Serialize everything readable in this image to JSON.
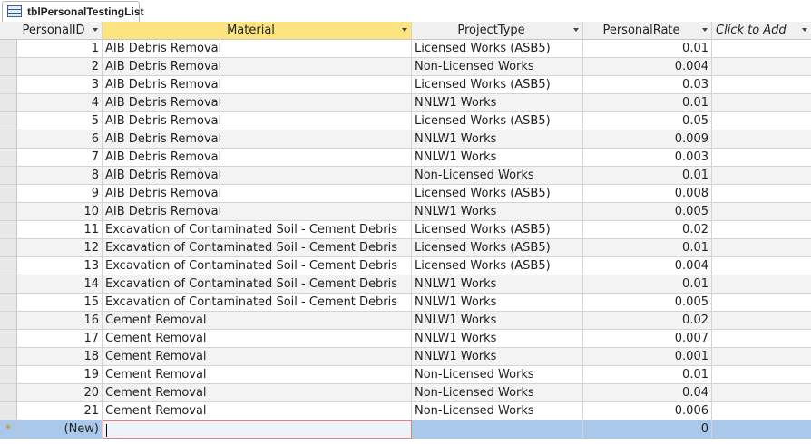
{
  "tab": {
    "title": "tblPersonalTestingList",
    "icon": "table-icon"
  },
  "columns": {
    "id": "PersonalID",
    "material": "Material",
    "project_type": "ProjectType",
    "personal_rate": "PersonalRate",
    "add": "Click to Add"
  },
  "rows": [
    {
      "id": "1",
      "material": "AIB Debris Removal",
      "project_type": "Licensed Works (ASB5)",
      "personal_rate": "0.01"
    },
    {
      "id": "2",
      "material": "AIB Debris Removal",
      "project_type": "Non-Licensed Works",
      "personal_rate": "0.004"
    },
    {
      "id": "3",
      "material": "AIB Debris Removal",
      "project_type": "Licensed Works (ASB5)",
      "personal_rate": "0.03"
    },
    {
      "id": "4",
      "material": "AIB Debris Removal",
      "project_type": "NNLW1 Works",
      "personal_rate": "0.01"
    },
    {
      "id": "5",
      "material": "AIB Debris Removal",
      "project_type": "Licensed Works (ASB5)",
      "personal_rate": "0.05"
    },
    {
      "id": "6",
      "material": "AIB Debris Removal",
      "project_type": "NNLW1 Works",
      "personal_rate": "0.009"
    },
    {
      "id": "7",
      "material": "AIB Debris Removal",
      "project_type": "NNLW1 Works",
      "personal_rate": "0.003"
    },
    {
      "id": "8",
      "material": "AIB Debris Removal",
      "project_type": "Non-Licensed Works",
      "personal_rate": "0.01"
    },
    {
      "id": "9",
      "material": "AIB Debris Removal",
      "project_type": "Licensed Works (ASB5)",
      "personal_rate": "0.008"
    },
    {
      "id": "10",
      "material": "AIB Debris Removal",
      "project_type": "NNLW1 Works",
      "personal_rate": "0.005"
    },
    {
      "id": "11",
      "material": "Excavation of Contaminated Soil - Cement Debris",
      "project_type": "Licensed Works (ASB5)",
      "personal_rate": "0.02"
    },
    {
      "id": "12",
      "material": "Excavation of Contaminated Soil - Cement Debris",
      "project_type": "Licensed Works (ASB5)",
      "personal_rate": "0.01"
    },
    {
      "id": "13",
      "material": "Excavation of Contaminated Soil - Cement Debris",
      "project_type": "Licensed Works (ASB5)",
      "personal_rate": "0.004"
    },
    {
      "id": "14",
      "material": "Excavation of Contaminated Soil - Cement Debris",
      "project_type": "NNLW1 Works",
      "personal_rate": "0.01"
    },
    {
      "id": "15",
      "material": "Excavation of Contaminated Soil - Cement Debris",
      "project_type": "NNLW1 Works",
      "personal_rate": "0.005"
    },
    {
      "id": "16",
      "material": "Cement Removal",
      "project_type": "NNLW1 Works",
      "personal_rate": "0.02"
    },
    {
      "id": "17",
      "material": "Cement Removal",
      "project_type": "NNLW1 Works",
      "personal_rate": "0.007"
    },
    {
      "id": "18",
      "material": "Cement Removal",
      "project_type": "NNLW1 Works",
      "personal_rate": "0.001"
    },
    {
      "id": "19",
      "material": "Cement Removal",
      "project_type": "Non-Licensed Works",
      "personal_rate": "0.01"
    },
    {
      "id": "20",
      "material": "Cement Removal",
      "project_type": "Non-Licensed Works",
      "personal_rate": "0.04"
    },
    {
      "id": "21",
      "material": "Cement Removal",
      "project_type": "Non-Licensed Works",
      "personal_rate": "0.006"
    }
  ],
  "new_row": {
    "marker": "*",
    "id": "(New)",
    "material": "",
    "project_type": "",
    "personal_rate": "0"
  },
  "colors": {
    "selected_header": "#fce480",
    "new_row": "#a9c8ea",
    "alt_row": "#f3f3f3"
  }
}
